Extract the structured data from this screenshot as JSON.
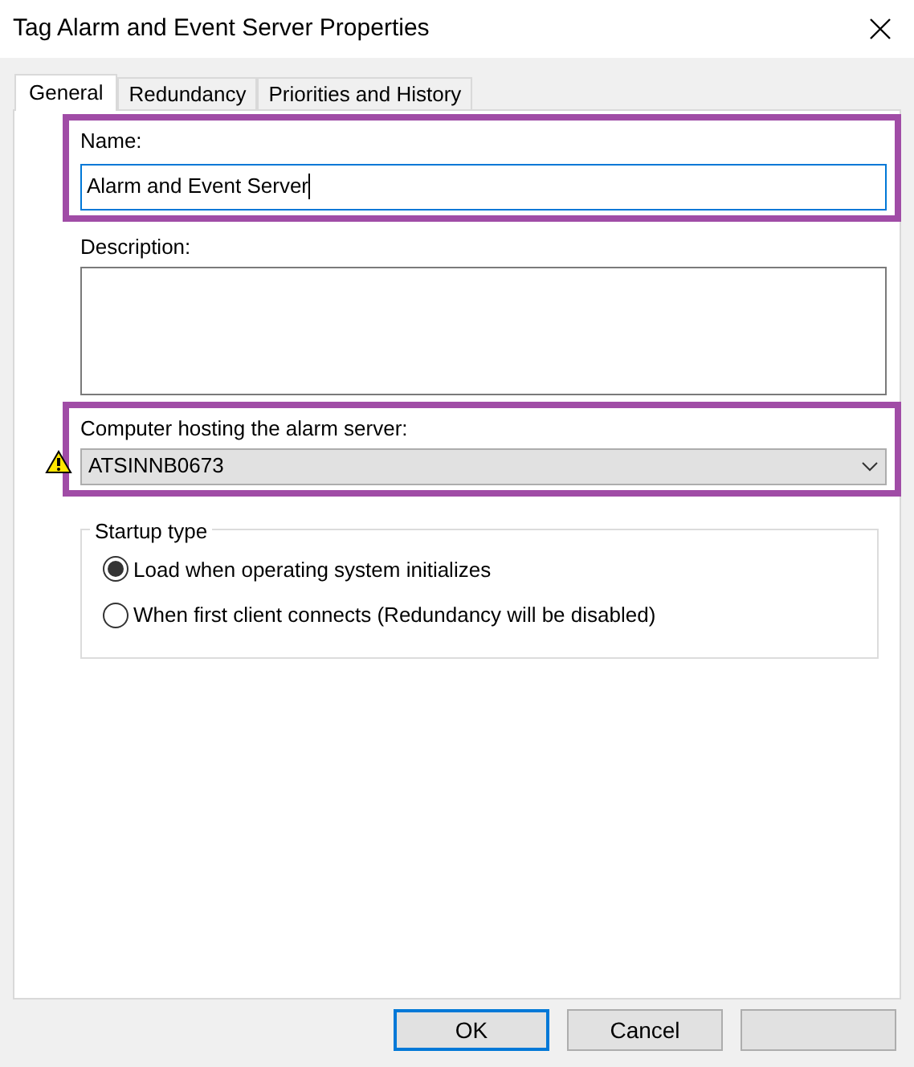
{
  "window": {
    "title": "Tag Alarm and Event Server Properties"
  },
  "tabs": [
    {
      "label": "General",
      "selected": true
    },
    {
      "label": "Redundancy",
      "selected": false
    },
    {
      "label": "Priorities and History",
      "selected": false
    }
  ],
  "name_field": {
    "label": "Name:",
    "value": "Alarm and Event Server",
    "highlighted": true,
    "focused": true
  },
  "description_field": {
    "label": "Description:"
  },
  "computer_field": {
    "label": "Computer hosting the alarm server:",
    "value": "ATSINNB0673",
    "highlighted": true,
    "warning": true
  },
  "startup_type": {
    "title": "Startup type",
    "options": [
      {
        "label": "Load when operating system initializes",
        "selected": true
      },
      {
        "label": "When first client connects (Redundancy will be disabled)",
        "selected": false
      }
    ]
  },
  "buttons": [
    {
      "kind": "default",
      "label": "OK"
    },
    {
      "kind": "normal",
      "label": "Cancel"
    },
    {
      "kind": "hidden"
    }
  ]
}
